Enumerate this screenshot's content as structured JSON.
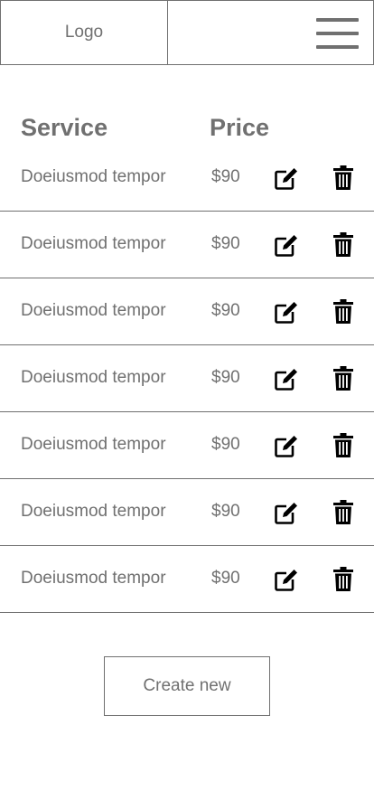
{
  "header": {
    "logo_text": "Logo",
    "menu_icon": "hamburger-menu-icon"
  },
  "table": {
    "columns": [
      "Service",
      "Price"
    ],
    "rows": [
      {
        "service": "Doeiusmod tempor",
        "price": "$90"
      },
      {
        "service": "Doeiusmod tempor",
        "price": "$90"
      },
      {
        "service": "Doeiusmod tempor",
        "price": "$90"
      },
      {
        "service": "Doeiusmod tempor",
        "price": "$90"
      },
      {
        "service": "Doeiusmod tempor",
        "price": "$90"
      },
      {
        "service": "Doeiusmod tempor",
        "price": "$90"
      },
      {
        "service": "Doeiusmod tempor",
        "price": "$90"
      }
    ],
    "row_icons": {
      "edit": "edit-icon",
      "delete": "trash-icon"
    }
  },
  "actions": {
    "create_label": "Create new"
  },
  "colors": {
    "text": "#707070",
    "border": "#707070",
    "icon": "#000000",
    "background": "#ffffff"
  }
}
